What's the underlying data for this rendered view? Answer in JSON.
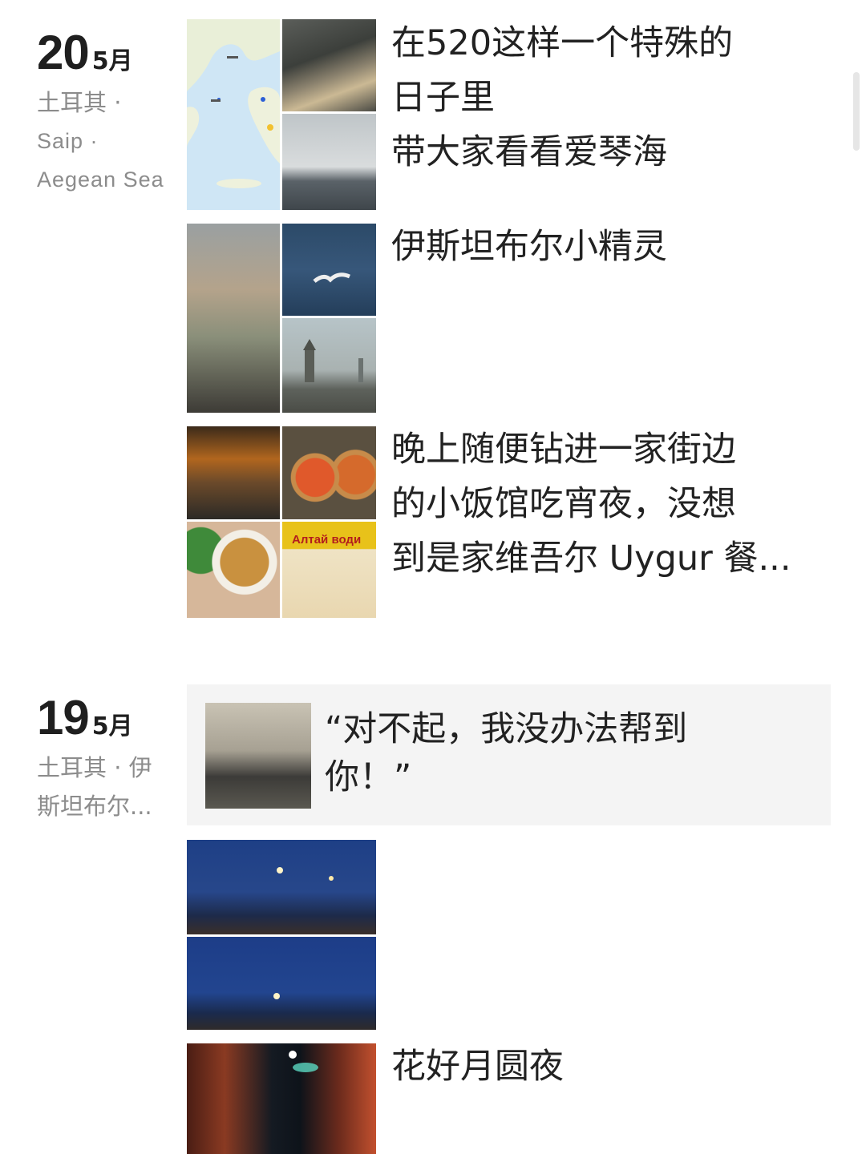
{
  "groups": [
    {
      "day": "20",
      "month": "5月",
      "location_line1": "土耳其 ·",
      "location_line2": "Saip ·",
      "location_line3": "Aegean Sea"
    },
    {
      "day": "19",
      "month": "5月",
      "location_line1": "土耳其 · 伊",
      "location_line2": "斯坦布尔..."
    }
  ],
  "posts": [
    {
      "text": "在520这样一个特殊的\n日子里\n带大家看看爱琴海"
    },
    {
      "text": "伊斯坦布尔小精灵"
    },
    {
      "text": "晚上随便钻进一家街边\n的小饭馆吃宵夜，没想\n到是家维吾尔 Uygur 餐..."
    },
    {
      "text": "“对不起，我没办法帮到\n你！”"
    },
    {
      "text": ""
    },
    {
      "text": "花好月圆夜"
    }
  ],
  "photo_signs": {
    "restaurant_sign": "Алтай води"
  },
  "icons": {
    "map": "map-thumbnail"
  }
}
